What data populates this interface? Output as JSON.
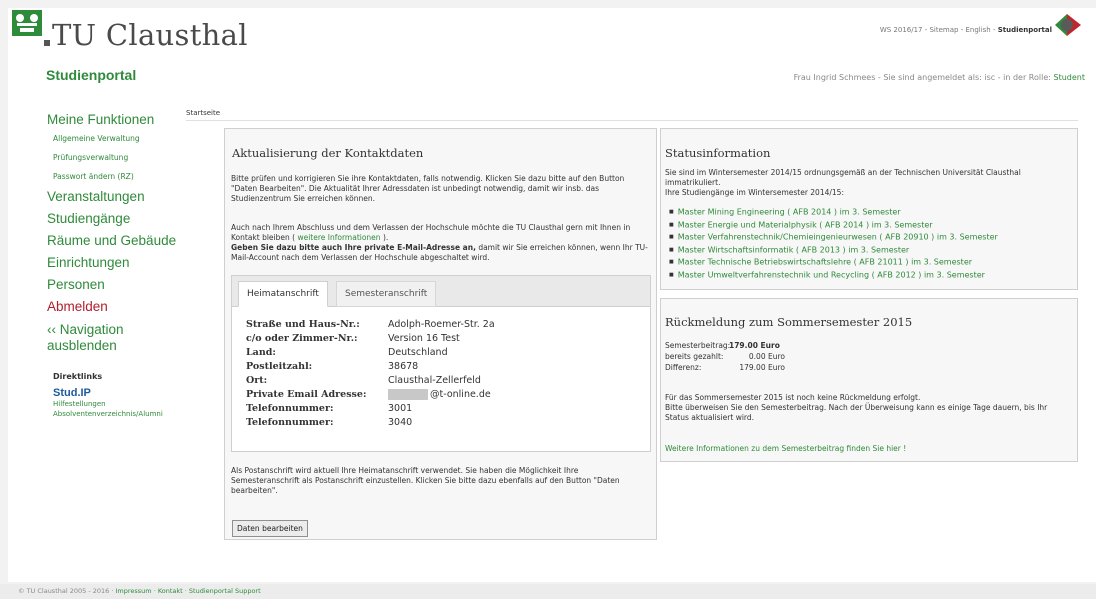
{
  "header": {
    "title": "TU Clausthal",
    "subtitle": "Studienportal",
    "topnav": {
      "semester": "WS 2016/17",
      "sitemap": "Sitemap",
      "english": "English",
      "portal": "Studienportal",
      "sep": " - "
    },
    "user": {
      "name": "Frau Ingrid Schmees",
      "logged_in": "Sie sind angemeldet als: isc",
      "role_prefix": "in der Rolle:",
      "role": "Student",
      "sep": " - "
    }
  },
  "breadcrumb": "Startseite",
  "sidebar": {
    "my_functions": "Meine Funktionen",
    "sub_items": [
      "Allgemeine Verwaltung",
      "Prüfungsverwaltung",
      "Passwort ändern (RZ)"
    ],
    "items": [
      "Veranstaltungen",
      "Studiengänge",
      "Räume und Gebäude",
      "Einrichtungen",
      "Personen"
    ],
    "logout": "Abmelden",
    "hide_nav": "‹‹ Navigation ausblenden",
    "direct_title": "Direktlinks",
    "studip": "Stud.IP",
    "direct_links": [
      "Hilfestellungen",
      "Absolventenverzeichnis/Alumni"
    ]
  },
  "contact": {
    "title": "Aktualisierung der Kontaktdaten",
    "intro": "Bitte prüfen und korrigieren Sie ihre Kontaktdaten, falls notwendig. Klicken Sie dazu bitte auf den Button \"Daten Bearbeiten\". Die Aktualität Ihrer Adressdaten ist unbedingt notwendig, damit wir insb. das Studienzentrum Sie erreichen können.",
    "contact_pre": "Auch nach Ihrem Abschluss und dem Verlassen der Hochschule möchte die TU Clausthal gern mit Ihnen in Kontakt bleiben (",
    "more_info_link": "weitere Informationen",
    "contact_post": ").",
    "email_bold": "Geben Sie dazu bitte auch Ihre private E-Mail-Adresse an,",
    "email_rest": "damit wir Sie erreichen können, wenn Ihr TU-Mail-Account nach dem Verlassen der Hochschule abgeschaltet wird.",
    "tabs": [
      "Heimatanschrift",
      "Semesteranschrift"
    ],
    "address": [
      {
        "label": "Straße und Haus-Nr.:",
        "value": "Adolph-Roemer-Str. 2a"
      },
      {
        "label": "c/o oder Zimmer-Nr.:",
        "value": "Version 16 Test"
      },
      {
        "label": "Land:",
        "value": "Deutschland"
      },
      {
        "label": "Postleitzahl:",
        "value": "38678"
      },
      {
        "label": "Ort:",
        "value": "Clausthal-Zellerfeld"
      },
      {
        "label": "Private Email Adresse:",
        "value": "@t-online.de"
      },
      {
        "label": "Telefonnummer:",
        "value": "3001"
      },
      {
        "label": "Telefonnummer:",
        "value": "3040"
      }
    ],
    "postal_note": "Als Postanschrift wird aktuell Ihre Heimatanschrift verwendet. Sie haben die Möglichkeit Ihre Semesteranschrift als Postanschrift einzustellen. Klicken Sie bitte dazu ebenfalls auf den Button \"Daten bearbeiten\".",
    "edit_button": "Daten bearbeiten"
  },
  "status": {
    "title": "Statusinformation",
    "line1": "Sie sind im Wintersemester 2014/15 ordnungsgemäß an der Technischen Universität Clausthal immatrikuliert.",
    "line2": "Ihre Studiengänge im Wintersemester 2014/15:",
    "programs": [
      "Master Mining Engineering ( AFB 2014 ) im 3. Semester",
      "Master Energie und Materialphysik ( AFB 2014 ) im 3. Semester",
      "Master Verfahrenstechnik/Chemieingenieurwesen ( AFB 20910 ) im 3. Semester",
      "Master Wirtschaftsinformatik ( AFB 2013 ) im 3. Semester",
      "Master Technische Betriebswirtschaftslehre ( AFB 21011 ) im 3. Semester",
      "Master Umweltverfahrenstechnik und Recycling ( AFB 2012 ) im 3. Semester"
    ]
  },
  "feedback": {
    "title": "Rückmeldung zum Sommersemester 2015",
    "fee_label": "Semesterbeitrag:",
    "fee_value": "179.00 Euro",
    "paid_label": "bereits gezahlt:",
    "paid_value": "0.00 Euro",
    "diff_label": "Differenz:",
    "diff_value": "179.00 Euro",
    "note1": "Für das Sommersemester 2015 ist noch keine Rückmeldung erfolgt.",
    "note2": "Bitte überweisen Sie den Semesterbeitrag. Nach der Überweisung kann es einige Tage dauern, bis Ihr Status aktualisiert wird.",
    "more_link": "Weitere Informationen zu dem Semesterbeitrag finden Sie hier !"
  },
  "footer": {
    "copyright": "© TU Clausthal 2005 - 2016",
    "links": [
      "Impressum",
      "Kontakt",
      "Studienportal Support"
    ],
    "sep": " · "
  },
  "colors": {
    "brand_green": "#2f8a3b",
    "logout_red": "#b01e2a"
  }
}
